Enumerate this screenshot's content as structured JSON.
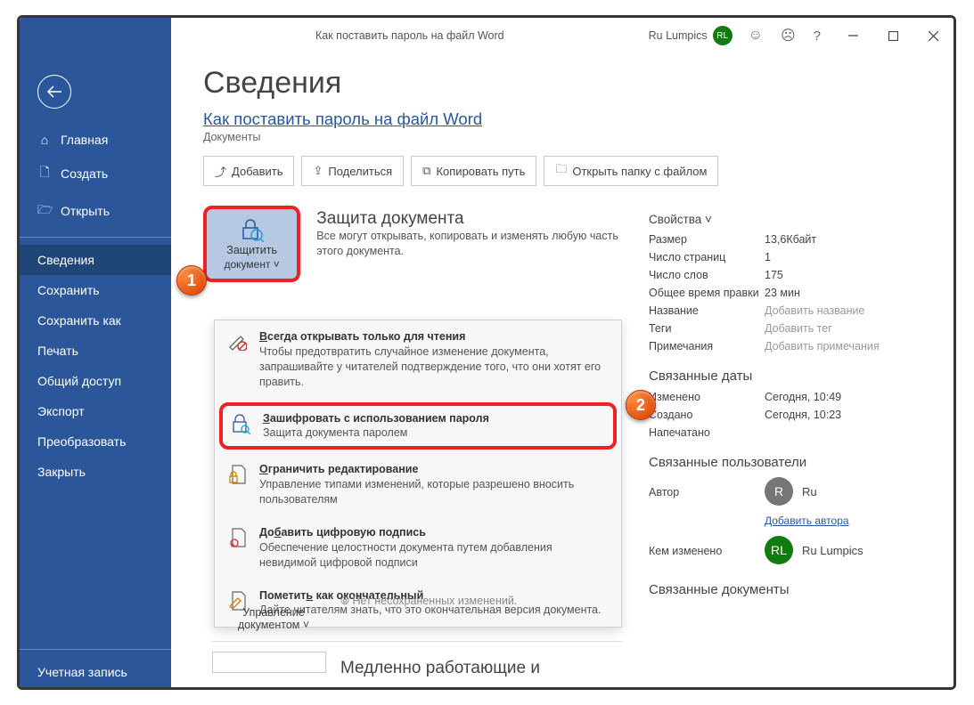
{
  "titlebar": {
    "title": "Как поставить пароль на файл Word",
    "user_name": "Ru Lumpics",
    "user_initials": "RL"
  },
  "sidebar": {
    "home": "Главная",
    "new": "Создать",
    "open": "Открыть",
    "info": "Сведения",
    "save": "Сохранить",
    "saveas": "Сохранить как",
    "print": "Печать",
    "share": "Общий доступ",
    "export": "Экспорт",
    "transform": "Преобразовать",
    "close": "Закрыть",
    "account": "Учетная запись"
  },
  "page": {
    "heading": "Сведения",
    "doc_title": "Как поставить пароль на файл Word",
    "doc_location": "Документы"
  },
  "actions": {
    "add": "Добавить",
    "share": "Поделиться",
    "copy_path": "Копировать путь",
    "open_folder": "Открыть папку с файлом"
  },
  "protect": {
    "tile_line1": "Защитить",
    "tile_line2": "документ",
    "section_title": "Защита документа",
    "section_desc": "Все могут открывать, копировать и изменять любую часть этого документа."
  },
  "menu": {
    "readonly_title": "Всегда открывать только для чтения",
    "readonly_desc": "Чтобы предотвратить случайное изменение документа, запрашивайте у читателей подтверждение того, что они хотят его править.",
    "encrypt_title": "Зашифровать с использованием пароля",
    "encrypt_desc": "Защита документа паролем",
    "restrict_title": "Ограничить редактирование",
    "restrict_desc": "Управление типами изменений, которые разрешено вносить пользователям",
    "sign_title": "Добавить цифровую подпись",
    "sign_desc": "Обеспечение целостности документа путем добавления невидимой цифровой подписи",
    "final_title": "Пометить как окончательный",
    "final_desc": "Дайте читателям знать, что это окончательная версия документа."
  },
  "manage": {
    "line1": "Управление",
    "line2": "документом",
    "partial": "Нет несохраненных изменений.",
    "slow_heading": "Медленно работающие и"
  },
  "markers": {
    "one": "1",
    "two": "2"
  },
  "props": {
    "heading": "Свойства",
    "size_k": "Размер",
    "size_v": "13,6Кбайт",
    "pages_k": "Число страниц",
    "pages_v": "1",
    "words_k": "Число слов",
    "words_v": "175",
    "edit_k": "Общее время правки",
    "edit_v": "23 мин",
    "title_k": "Название",
    "title_ph": "Добавить название",
    "tags_k": "Теги",
    "tags_ph": "Добавить тег",
    "comments_k": "Примечания",
    "comments_ph": "Добавить примечания"
  },
  "dates": {
    "heading": "Связанные даты",
    "modified_k": "Изменено",
    "modified_v": "Сегодня, 10:49",
    "created_k": "Создано",
    "created_v": "Сегодня, 10:23",
    "printed_k": "Напечатано"
  },
  "people": {
    "heading": "Связанные пользователи",
    "author_k": "Автор",
    "author_initial": "R",
    "author_name": "Ru",
    "add_author": "Добавить автора",
    "lastmod_k": "Кем изменено",
    "lastmod_initials": "RL",
    "lastmod_name": "Ru Lumpics"
  },
  "related_docs": {
    "heading": "Связанные документы"
  }
}
